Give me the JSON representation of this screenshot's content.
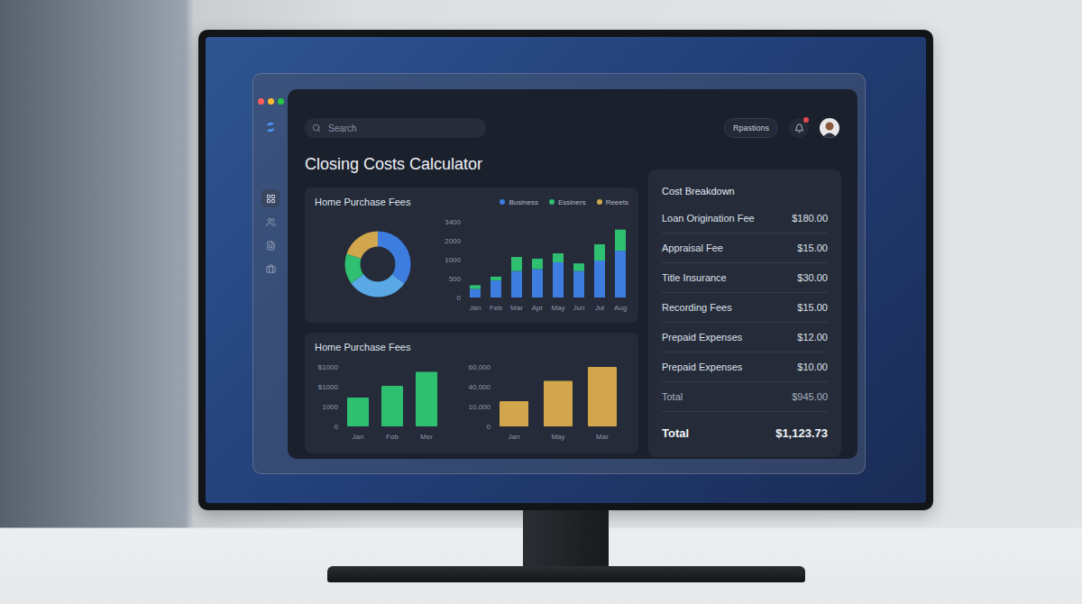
{
  "window": {
    "controls": [
      {
        "color": "#ff5f57"
      },
      {
        "color": "#febc2e"
      },
      {
        "color": "#28c840"
      }
    ]
  },
  "sidebar": {
    "items": [
      {
        "kind": "grid",
        "selected": true
      },
      {
        "kind": "users",
        "selected": false
      },
      {
        "kind": "document",
        "selected": false
      },
      {
        "kind": "briefcase",
        "selected": false
      }
    ]
  },
  "header": {
    "search": {
      "placeholder": "Search"
    },
    "button": "Rpastions",
    "notifications": {
      "unread": true
    }
  },
  "title": "Closing Costs Calculator",
  "purchase_chart": {
    "title": "Home Purchase Fees",
    "legend": [
      {
        "label": "Business",
        "color": "#3d7de0"
      },
      {
        "label": "Essiners",
        "color": "#2fbf71"
      },
      {
        "label": "Reeets",
        "color": "#d1a64c"
      }
    ],
    "donut": [
      {
        "value": 35,
        "color": "#3d7de0"
      },
      {
        "value": 30,
        "color": "#5aa8e6"
      },
      {
        "value": 15,
        "color": "#2fbf71"
      },
      {
        "value": 20,
        "color": "#d1a64c"
      }
    ],
    "y_ticks": [
      "3400",
      "2000",
      "1000",
      "500",
      "0"
    ],
    "x_labels": [
      "Jan",
      "Feb",
      "Mar",
      "Apr",
      "May",
      "Jun",
      "Jul",
      "Aug"
    ],
    "series": [
      {
        "name": "Business",
        "color": "#3d7de0",
        "values": [
          225,
          450,
          700,
          750,
          930,
          700,
          975,
          1470
        ]
      },
      {
        "name": "Essiners",
        "color": "#2fbf71",
        "values": [
          100,
          100,
          440,
          300,
          400,
          200,
          835,
          1350
        ]
      }
    ]
  },
  "monthly_chart": {
    "title": "Home Purchase Fees",
    "panels": [
      {
        "y_ticks": [
          "$1000",
          "$1000",
          "1000",
          "0"
        ],
        "max": 3000,
        "color": "#2fbf71",
        "x_labels": [
          "Jan",
          "Fob",
          "Mer"
        ],
        "values": [
          1450,
          2050,
          2750
        ]
      },
      {
        "y_ticks": [
          "60,000",
          "40,000",
          "10,000",
          "0"
        ],
        "max": 60000,
        "color": "#d1a64c",
        "x_labels": [
          "Jan",
          "May",
          "Mar"
        ],
        "values": [
          25500,
          46000,
          60000
        ]
      }
    ]
  },
  "cost_breakdown": {
    "title": "Cost Breakdown",
    "rows": [
      {
        "label": "Loan Origination Fee",
        "value": "$180.00"
      },
      {
        "label": "Appraisal Fee",
        "value": "$15.00"
      },
      {
        "label": "Title Insurance",
        "value": "$30.00"
      },
      {
        "label": "Recording Fees",
        "value": "$15.00"
      },
      {
        "label": "Prepaid Expenses",
        "value": "$12.00"
      },
      {
        "label": "Prepaid Expenses",
        "value": "$10.00"
      },
      {
        "label": "Total",
        "value": "$945.00"
      }
    ],
    "total": {
      "label": "Total",
      "value": "$1,123.73"
    }
  }
}
